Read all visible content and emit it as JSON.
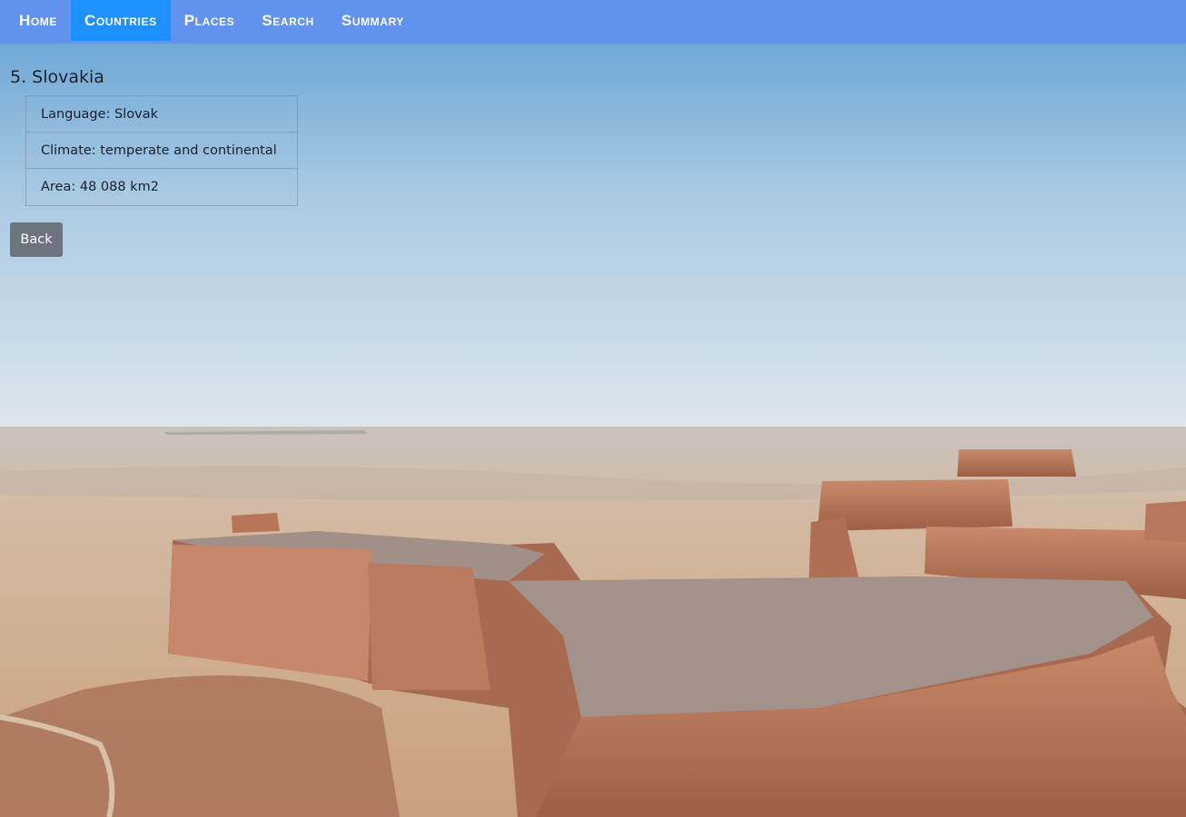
{
  "nav": {
    "items": [
      {
        "label": "Home",
        "active": false
      },
      {
        "label": "Countries",
        "active": true
      },
      {
        "label": "Places",
        "active": false
      },
      {
        "label": "Search",
        "active": false
      },
      {
        "label": "Summary",
        "active": false
      }
    ],
    "colors": {
      "bar": "#6193ee",
      "active": "#1e90ff"
    }
  },
  "country": {
    "title": "5. Slovakia",
    "details": [
      "Language: Slovak",
      "Climate: temperate and continental",
      "Area: 48 088 km2"
    ]
  },
  "back_button": {
    "label": "Back",
    "color": "#6c757d"
  },
  "background": {
    "subject": "desert-canyon-landscape-photo"
  }
}
